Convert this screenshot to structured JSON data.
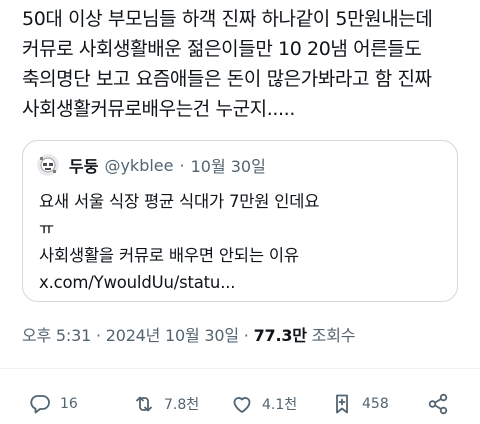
{
  "tweet": {
    "lines": [
      "50대 이상 부모님들 하객 진짜 하나같이 5만원내는데",
      "커뮤로 사회생활배운 젊은이들만 10 20냄 어른들도",
      "축의명단 보고 요즘애들은 돈이 많은가봐라고 함 진짜",
      "사회생활커뮤로배우는건 누군지....."
    ]
  },
  "quote": {
    "name": "두둥",
    "handle": "@ykblee",
    "separator": "·",
    "date": "10월 30일",
    "lines": [
      "요새 서울 식장 평균 식대가 7만원 인데요",
      "ㅠ",
      "사회생활을 커뮤로 배우면 안되는 이유",
      "x.com/YwouldUu/statu..."
    ]
  },
  "meta": {
    "time": "오후 5:31",
    "dot1": "·",
    "date": "2024년 10월 30일",
    "dot2": "·",
    "views": "77.3만",
    "views_label": "조회수"
  },
  "actions": {
    "reply": {
      "icon": "reply-icon",
      "count": "16"
    },
    "retweet": {
      "icon": "retweet-icon",
      "count": "7.8천"
    },
    "like": {
      "icon": "heart-icon",
      "count": "4.1천"
    },
    "bookmark": {
      "icon": "bookmark-icon",
      "count": "458"
    },
    "share": {
      "icon": "share-icon"
    }
  },
  "colors": {
    "text": "#0f1419",
    "secondary": "#536471",
    "border": "#cfd9de"
  }
}
